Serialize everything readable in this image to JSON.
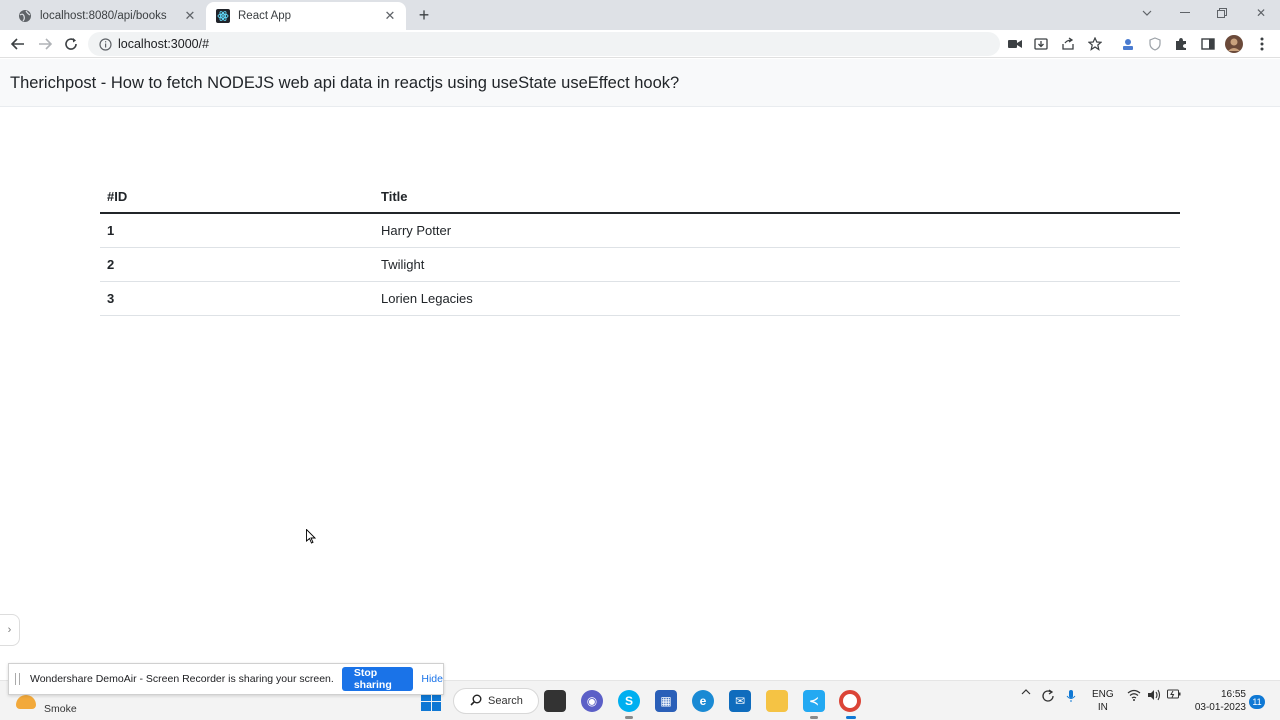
{
  "browser": {
    "tabs": [
      {
        "title": "localhost:8080/api/books",
        "active": false
      },
      {
        "title": "React App",
        "active": true
      }
    ],
    "url": "localhost:3000/#"
  },
  "header": {
    "title": "Therichpost - How to fetch NODEJS web api data in reactjs using useState useEffect hook?"
  },
  "table": {
    "columns": [
      "#ID",
      "Title"
    ],
    "rows": [
      {
        "id": "1",
        "title": "Harry Potter"
      },
      {
        "id": "2",
        "title": "Twilight"
      },
      {
        "id": "3",
        "title": "Lorien Legacies"
      }
    ]
  },
  "share_banner": {
    "message": "Wondershare DemoAir - Screen Recorder is sharing your screen.",
    "stop_label": "Stop sharing",
    "hide_label": "Hide"
  },
  "taskbar": {
    "weather_text": "Smoke",
    "search_label": "Search",
    "lang_line1": "ENG",
    "lang_line2": "IN",
    "time": "16:55",
    "date": "03-01-2023",
    "notification_count": "11"
  },
  "colors": {
    "accent": "#1a73e8",
    "windows_blue": "#0f78d4"
  }
}
